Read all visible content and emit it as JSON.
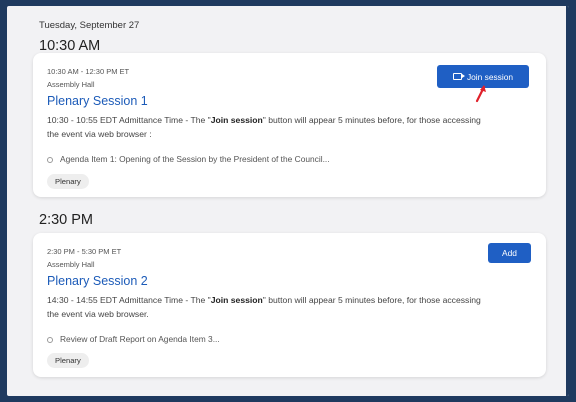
{
  "schedule": {
    "date": "Tuesday, September 27",
    "groups": [
      {
        "time": "10:30 AM",
        "session": {
          "range": "10:30 AM - 12:30 PM ET",
          "room": "Assembly Hall",
          "title": "Plenary Session 1",
          "desc_pre": "10:30 - 10:55 EDT Admittance Time - The \"",
          "desc_bold": "Join session",
          "desc_post": "\" button will appear 5 minutes before, for those accessing the event via web browser :",
          "agenda": "Agenda Item 1: Opening of the Session by the President of the Council...",
          "tag": "Plenary",
          "button": "Join session",
          "button_icon": "video-camera-icon"
        }
      },
      {
        "time": "2:30 PM",
        "session": {
          "range": "2:30 PM - 5:30 PM ET",
          "room": "Assembly Hall",
          "title": "Plenary Session 2",
          "desc_pre": "14:30 - 14:55 EDT Admittance Time - The \"",
          "desc_bold": "Join session",
          "desc_post": "\" button will appear 5 minutes before, for those accessing the event via web browser.",
          "agenda": "Review of Draft Report on Agenda Item 3...",
          "tag": "Plenary",
          "button": "Add"
        }
      }
    ]
  },
  "colors": {
    "accent": "#1f5fc4",
    "title": "#1c5bb8",
    "annotation_arrow": "#e0202a",
    "frame_border": "#1f3a5f"
  }
}
